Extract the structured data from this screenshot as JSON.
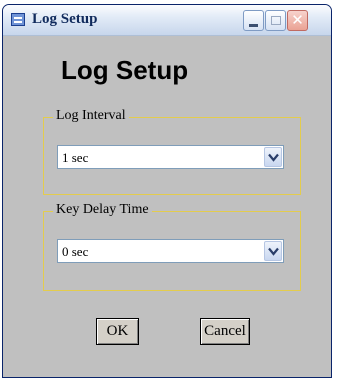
{
  "window": {
    "title": "Log Setup",
    "icon": "window-app-icon",
    "controls": [
      "minimize-icon",
      "maximize-icon",
      "close-icon"
    ]
  },
  "heading": "Log Setup",
  "log_interval": {
    "label": "Log Interval",
    "selected": "1 sec"
  },
  "key_delay_time": {
    "label": "Key Delay Time",
    "selected": "0 sec"
  },
  "buttons": {
    "ok": "OK",
    "cancel": "Cancel"
  },
  "colors": {
    "dialog_bg": "#c0c0c0",
    "group_border": "#e3cc4d",
    "close_button": "#eaa294"
  }
}
